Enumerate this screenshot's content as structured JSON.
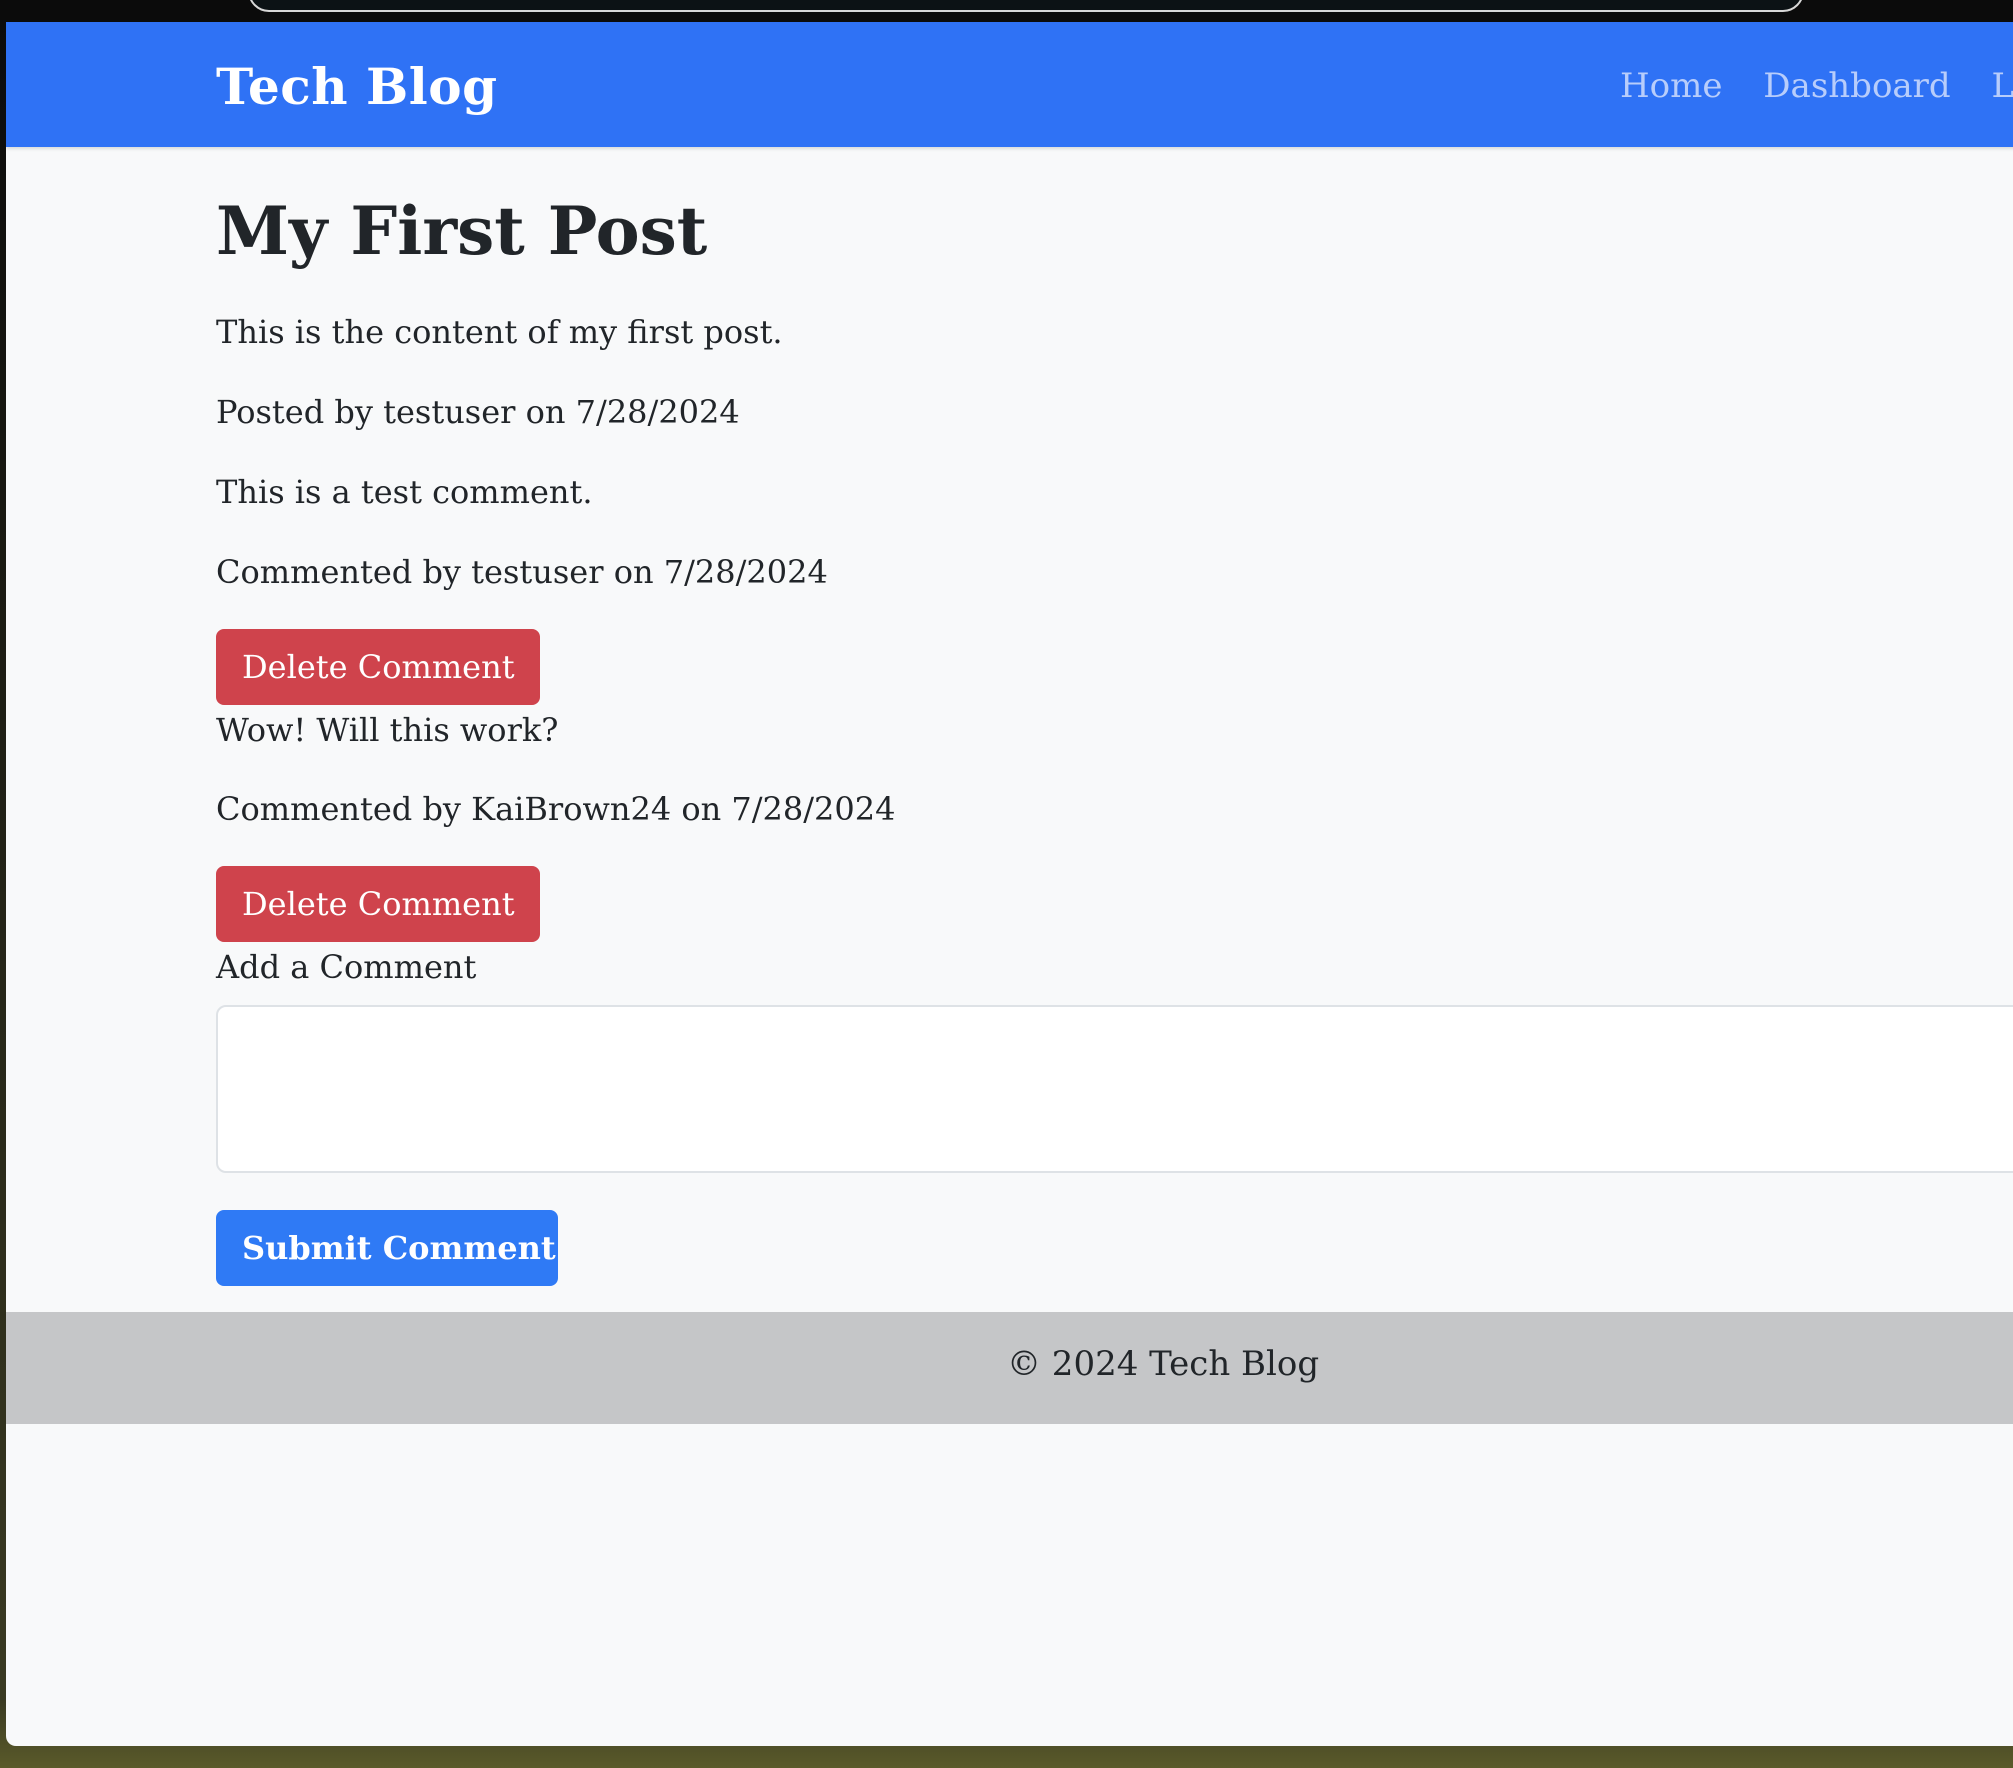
{
  "navbar": {
    "brand": "Tech Blog",
    "links": [
      "Home",
      "Dashboard",
      "Log"
    ]
  },
  "post": {
    "title": "My First Post",
    "content": "This is the content of my first post.",
    "meta": "Posted by testuser on 7/28/2024"
  },
  "comments": [
    {
      "text": "This is a test comment.",
      "meta": "Commented by testuser on 7/28/2024",
      "delete_label": "Delete Comment"
    },
    {
      "text": "Wow! Will this work?",
      "meta": "Commented by KaiBrown24 on 7/28/2024",
      "delete_label": "Delete Comment"
    }
  ],
  "comment_form": {
    "label": "Add a Comment",
    "value": "",
    "submit_label": "Submit Comment"
  },
  "footer": {
    "text": "© 2024 Tech Blog"
  },
  "colors": {
    "navbar": "#2f72f5",
    "delete_button": "#cf434c",
    "submit_button": "#2f7af5",
    "footer": "#c5c6c8",
    "page_background": "#f8f9fa"
  }
}
